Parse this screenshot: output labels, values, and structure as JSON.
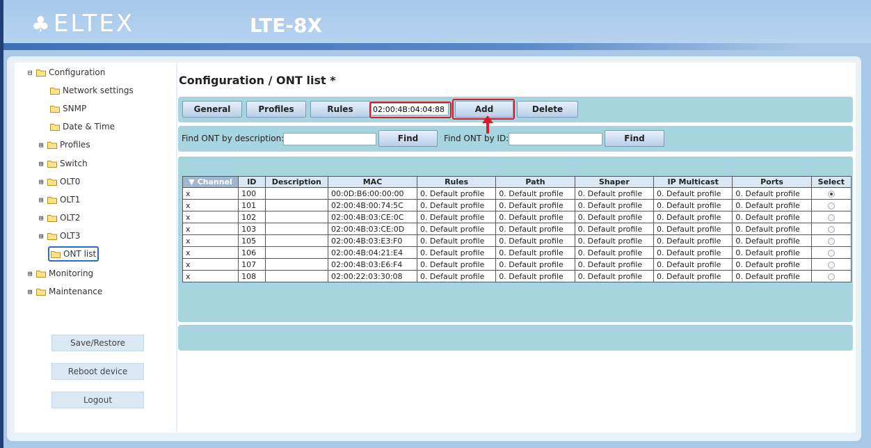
{
  "header": {
    "logo_text": "ELTEX",
    "device_model": "LTE-8X"
  },
  "sidebar": {
    "items": [
      {
        "label": "Configuration",
        "expander": "⊟",
        "indent": 0
      },
      {
        "label": "Network settings",
        "expander": "",
        "indent": 2
      },
      {
        "label": "SNMP",
        "expander": "",
        "indent": 2
      },
      {
        "label": "Date & Time",
        "expander": "",
        "indent": 2
      },
      {
        "label": "Profiles",
        "expander": "⊞",
        "indent": 1
      },
      {
        "label": "Switch",
        "expander": "⊞",
        "indent": 1
      },
      {
        "label": "OLT0",
        "expander": "⊞",
        "indent": 1
      },
      {
        "label": "OLT1",
        "expander": "⊞",
        "indent": 1
      },
      {
        "label": "OLT2",
        "expander": "⊞",
        "indent": 1
      },
      {
        "label": "OLT3",
        "expander": "⊞",
        "indent": 1
      },
      {
        "label": "ONT list",
        "expander": "",
        "indent": 2,
        "selected": true
      },
      {
        "label": "Monitoring",
        "expander": "⊞",
        "indent": 0
      },
      {
        "label": "Maintenance",
        "expander": "⊞",
        "indent": 0
      }
    ],
    "buttons": {
      "save_restore": "Save/Restore",
      "reboot": "Reboot device",
      "logout": "Logout"
    }
  },
  "main": {
    "title": "Configuration / ONT list *",
    "toolbar": {
      "general": "General",
      "profiles": "Profiles",
      "rules": "Rules",
      "mac_value": "02:00:4B:04:04:88",
      "add": "Add",
      "delete": "Delete"
    },
    "find": {
      "by_description_label": "Find ONT by description:",
      "by_description_value": "",
      "find_button_1": "Find",
      "by_id_label": "Find ONT by ID:",
      "by_id_value": "",
      "find_button_2": "Find"
    },
    "table": {
      "columns": [
        "Channel",
        "ID",
        "Description",
        "MAC",
        "Rules",
        "Path",
        "Shaper",
        "IP Multicast",
        "Ports",
        "Select"
      ],
      "sort_indicator": "▼",
      "rows": [
        {
          "channel": "x",
          "id": "100",
          "description": "",
          "mac": "00:0D:B6:00:00:00",
          "rules": "0. Default profile",
          "path": "0. Default profile",
          "shaper": "0. Default profile",
          "ip_multicast": "0. Default profile",
          "ports": "0. Default profile",
          "selected": true
        },
        {
          "channel": "x",
          "id": "101",
          "description": "",
          "mac": "02:00:4B:00:74:5C",
          "rules": "0. Default profile",
          "path": "0. Default profile",
          "shaper": "0. Default profile",
          "ip_multicast": "0. Default profile",
          "ports": "0. Default profile",
          "selected": false
        },
        {
          "channel": "x",
          "id": "102",
          "description": "",
          "mac": "02:00:4B:03:CE:0C",
          "rules": "0. Default profile",
          "path": "0. Default profile",
          "shaper": "0. Default profile",
          "ip_multicast": "0. Default profile",
          "ports": "0. Default profile",
          "selected": false
        },
        {
          "channel": "x",
          "id": "103",
          "description": "",
          "mac": "02:00:4B:03:CE:0D",
          "rules": "0. Default profile",
          "path": "0. Default profile",
          "shaper": "0. Default profile",
          "ip_multicast": "0. Default profile",
          "ports": "0. Default profile",
          "selected": false
        },
        {
          "channel": "x",
          "id": "105",
          "description": "",
          "mac": "02:00:4B:03:E3:F0",
          "rules": "0. Default profile",
          "path": "0. Default profile",
          "shaper": "0. Default profile",
          "ip_multicast": "0. Default profile",
          "ports": "0. Default profile",
          "selected": false
        },
        {
          "channel": "x",
          "id": "106",
          "description": "",
          "mac": "02:00:4B:04:21:E4",
          "rules": "0. Default profile",
          "path": "0. Default profile",
          "shaper": "0. Default profile",
          "ip_multicast": "0. Default profile",
          "ports": "0. Default profile",
          "selected": false
        },
        {
          "channel": "x",
          "id": "107",
          "description": "",
          "mac": "02:00:4B:03:E6:F4",
          "rules": "0. Default profile",
          "path": "0. Default profile",
          "shaper": "0. Default profile",
          "ip_multicast": "0. Default profile",
          "ports": "0. Default profile",
          "selected": false
        },
        {
          "channel": "x",
          "id": "108",
          "description": "",
          "mac": "02:00:22:03:30:08",
          "rules": "0. Default profile",
          "path": "0. Default profile",
          "shaper": "0. Default profile",
          "ip_multicast": "0. Default profile",
          "ports": "0. Default profile",
          "selected": false
        }
      ]
    }
  },
  "icons": {
    "folder": "folder-icon",
    "annotation_arrow": "arrow-up-icon"
  },
  "colors": {
    "highlight": "#d81b27",
    "header_bg": "#a9c8e7",
    "bar_bg": "#a6d4df",
    "selected_border": "#2a6cbe"
  }
}
